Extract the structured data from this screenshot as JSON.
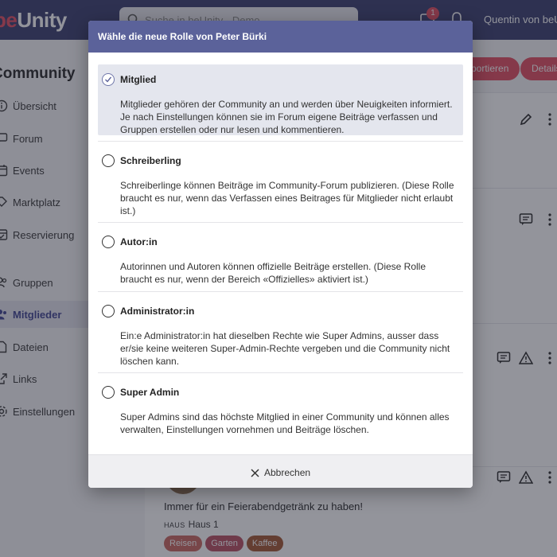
{
  "app": {
    "logo_prefix": "be",
    "logo_suffix": "Unity",
    "search_placeholder": "Suche in beUnity - Demo",
    "notification_count": "1",
    "user_name": "Quentin von beUnity"
  },
  "sidebar": {
    "title": "Community",
    "items": [
      {
        "label": "Übersicht",
        "icon": "info-icon"
      },
      {
        "label": "Forum",
        "icon": "chat-icon"
      },
      {
        "label": "Events",
        "icon": "calendar-icon"
      },
      {
        "label": "Marktplatz",
        "icon": "shop-icon"
      },
      {
        "label": "Reservierung",
        "icon": "reservation-icon"
      },
      {
        "label": "Gruppen",
        "icon": "groups-icon"
      },
      {
        "label": "Mitglieder",
        "icon": "members-icon",
        "active": true
      },
      {
        "label": "Dateien",
        "icon": "file-icon"
      },
      {
        "label": "Links",
        "icon": "link-icon"
      },
      {
        "label": "Einstellungen",
        "icon": "gear-icon"
      }
    ]
  },
  "main": {
    "button_export": "Exportieren",
    "button_details": "Details",
    "member_text": "Immer für ein Feierabendgetränk zu haben!",
    "house_prefix": "HAUS",
    "house": "Haus 1",
    "tags": [
      "Reisen",
      "Garten",
      "Kaffee"
    ]
  },
  "modal": {
    "title": "Wähle die neue Rolle von Peter Bürki",
    "options": [
      {
        "title": "Mitglied",
        "selected": true,
        "description": "Mitglieder gehören der Community an und werden über Neuigkeiten informiert. Je nach Einstellungen können sie im Forum eigene Beiträge verfassen und Gruppen erstellen oder nur lesen und kommentieren."
      },
      {
        "title": "Schreiberling",
        "selected": false,
        "description": "Schreiberlinge können Beiträge im Community-Forum publizieren. (Diese Rolle braucht es nur, wenn das Verfassen eines Beitrages für Mitglieder nicht erlaubt ist.)"
      },
      {
        "title": "Autor:in",
        "selected": false,
        "description": "Autorinnen und Autoren können offizielle Beiträge erstellen. (Diese Rolle braucht es nur, wenn der Bereich «Offizielles» aktiviert ist.)"
      },
      {
        "title": "Administrator:in",
        "selected": false,
        "description": "Ein:e Administrator:in hat dieselben Rechte wie Super Admins, ausser dass er/sie keine weiteren Super-Admin-Rechte vergeben und die Community nicht löschen kann."
      },
      {
        "title": "Super Admin",
        "selected": false,
        "description": "Super Admins sind das höchste Mitglied in einer Community und können alles verwalten, Einstellungen vornehmen und Beiträge löschen."
      }
    ],
    "cancel_label": "Abbrechen"
  },
  "colors": {
    "topbar": "#34386a",
    "accent": "#e2485c",
    "modal_header": "#5b629a",
    "selected_bg": "#e4e6ee",
    "tag_reisen": "#c8625a",
    "tag_garten": "#b64a5d",
    "tag_kaffee": "#a0522d"
  }
}
